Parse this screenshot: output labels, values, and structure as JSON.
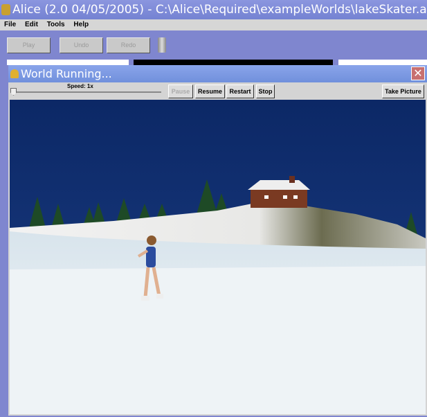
{
  "window": {
    "title": "Alice (2.0 04/05/2005) - C:\\Alice\\Required\\exampleWorlds\\lakeSkater.a"
  },
  "menu": [
    "File",
    "Edit",
    "Tools",
    "Help"
  ],
  "toolbar": {
    "play": "Play",
    "undo": "Undo",
    "redo": "Redo"
  },
  "dialog": {
    "title": "World Running...",
    "speed_label": "Speed: 1x",
    "speed_value": 1,
    "pause": "Pause",
    "resume": "Resume",
    "restart": "Restart",
    "stop": "Stop",
    "take_picture": "Take Picture"
  },
  "colors": {
    "sky": "#0e2b6b",
    "snow": "#f0f4f6",
    "titlebar": "#7a86d4"
  }
}
